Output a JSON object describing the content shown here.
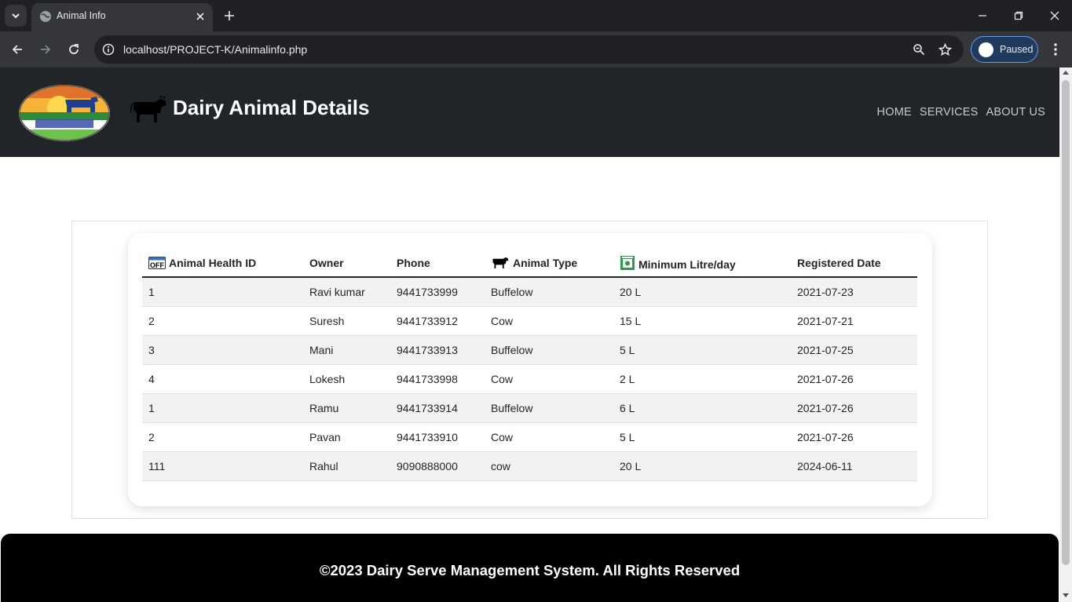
{
  "browser": {
    "tab_title": "Animal Info",
    "url": "localhost/PROJECT-K/Animalinfo.php",
    "profile_label": "Paused"
  },
  "header": {
    "title": "Dairy Animal Details",
    "nav": [
      "HOME",
      "SERVICES",
      "ABOUT US"
    ]
  },
  "table": {
    "columns": [
      "Animal Health ID",
      "Owner",
      "Phone",
      "Animal Type",
      "Minimum Litre/day",
      "Registered Date"
    ],
    "rows": [
      [
        "1",
        "Ravi kumar",
        "9441733999",
        "Buffelow",
        "20 L",
        "2021-07-23"
      ],
      [
        "2",
        "Suresh",
        "9441733912",
        "Cow",
        "15 L",
        "2021-07-21"
      ],
      [
        "3",
        "Mani",
        "9441733913",
        "Buffelow",
        "5 L",
        "2021-07-25"
      ],
      [
        "4",
        "Lokesh",
        "9441733998",
        "Cow",
        "2 L",
        "2021-07-26"
      ],
      [
        "1",
        "Ramu",
        "9441733914",
        "Buffelow",
        "6 L",
        "2021-07-26"
      ],
      [
        "2",
        "Pavan",
        "9441733910",
        "Cow",
        "5 L",
        "2021-07-26"
      ],
      [
        "111",
        "Rahul",
        "9090888000",
        "cow",
        "20 L",
        "2024-06-11"
      ]
    ]
  },
  "footer": {
    "text": "©2023 Dairy Serve Management System. All Rights Reserved"
  },
  "colors": {
    "header_bg": "#212529",
    "footer_bg": "#000000",
    "row_stripe": "#f2f2f2"
  }
}
